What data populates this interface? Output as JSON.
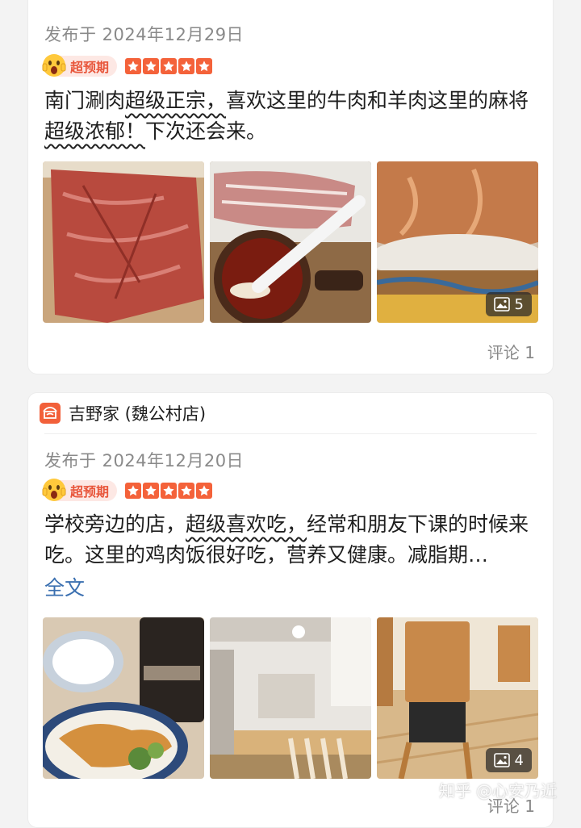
{
  "cards": [
    {
      "date": "发布于 2024年12月29日",
      "badge": "超预期",
      "rating": 5,
      "text_parts": [
        "南门涮肉",
        "超级正宗，",
        "喜欢这里的牛肉和羊肉这里的麻将",
        "超级浓郁！",
        "下次还会来。"
      ],
      "photo_count": "5",
      "comment": "评论 1"
    },
    {
      "shop": "吉野家 (魏公村店)",
      "date": "发布于 2024年12月20日",
      "badge": "超预期",
      "rating": 5,
      "text_parts": [
        "学校旁边的店，",
        "超级喜欢吃，",
        "经常和朋友下课的时候来吃。这里的鸡肉饭很好吃，营养又健康。减脂期…"
      ],
      "fulltext": "全文",
      "photo_count": "4",
      "comment": "评论 1"
    }
  ],
  "watermark": {
    "site": "知乎",
    "author": "@心安乃近"
  },
  "colors": {
    "accent": "#f4623a",
    "link": "#3a6fb0",
    "muted": "#8a8a8a"
  }
}
